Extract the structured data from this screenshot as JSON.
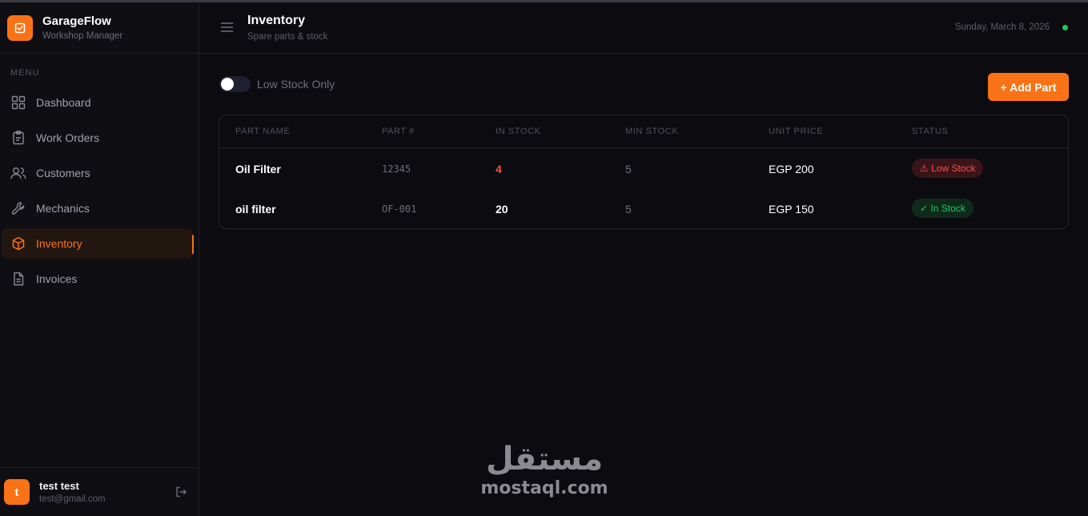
{
  "brand": {
    "name": "GarageFlow",
    "subtitle": "Workshop Manager"
  },
  "sidebar": {
    "menu_label": "MENU",
    "items": [
      {
        "label": "Dashboard",
        "icon": "grid-icon",
        "active": false
      },
      {
        "label": "Work Orders",
        "icon": "clipboard-icon",
        "active": false
      },
      {
        "label": "Customers",
        "icon": "users-icon",
        "active": false
      },
      {
        "label": "Mechanics",
        "icon": "wrench-icon",
        "active": false
      },
      {
        "label": "Inventory",
        "icon": "box-icon",
        "active": true
      },
      {
        "label": "Invoices",
        "icon": "file-icon",
        "active": false
      }
    ]
  },
  "user": {
    "initial": "t",
    "name": "test test",
    "email": "test@gmail.com"
  },
  "header": {
    "title": "Inventory",
    "subtitle": "Spare parts & stock",
    "date": "Sunday, March 8, 2026"
  },
  "toolbar": {
    "toggle_label": "Low Stock Only",
    "toggle_on": false,
    "add_label": "+ Add Part"
  },
  "table": {
    "columns": [
      "PART NAME",
      "PART #",
      "IN STOCK",
      "MIN STOCK",
      "UNIT PRICE",
      "STATUS"
    ],
    "rows": [
      {
        "name": "Oil Filter",
        "part_no": "12345",
        "in_stock": "4",
        "min_stock": "5",
        "price": "EGP 200",
        "status": "⚠ Low Stock"
      },
      {
        "name": "oil filter",
        "part_no": "OF-001",
        "in_stock": "20",
        "min_stock": "5",
        "price": "EGP 150",
        "status": "✓ In Stock"
      }
    ]
  },
  "watermark": {
    "arabic": "مستقل",
    "latin": "mostaql.com"
  },
  "colors": {
    "accent": "#f97316",
    "low": "#f05252",
    "ok": "#22c55e",
    "background": "#0c0c10"
  }
}
